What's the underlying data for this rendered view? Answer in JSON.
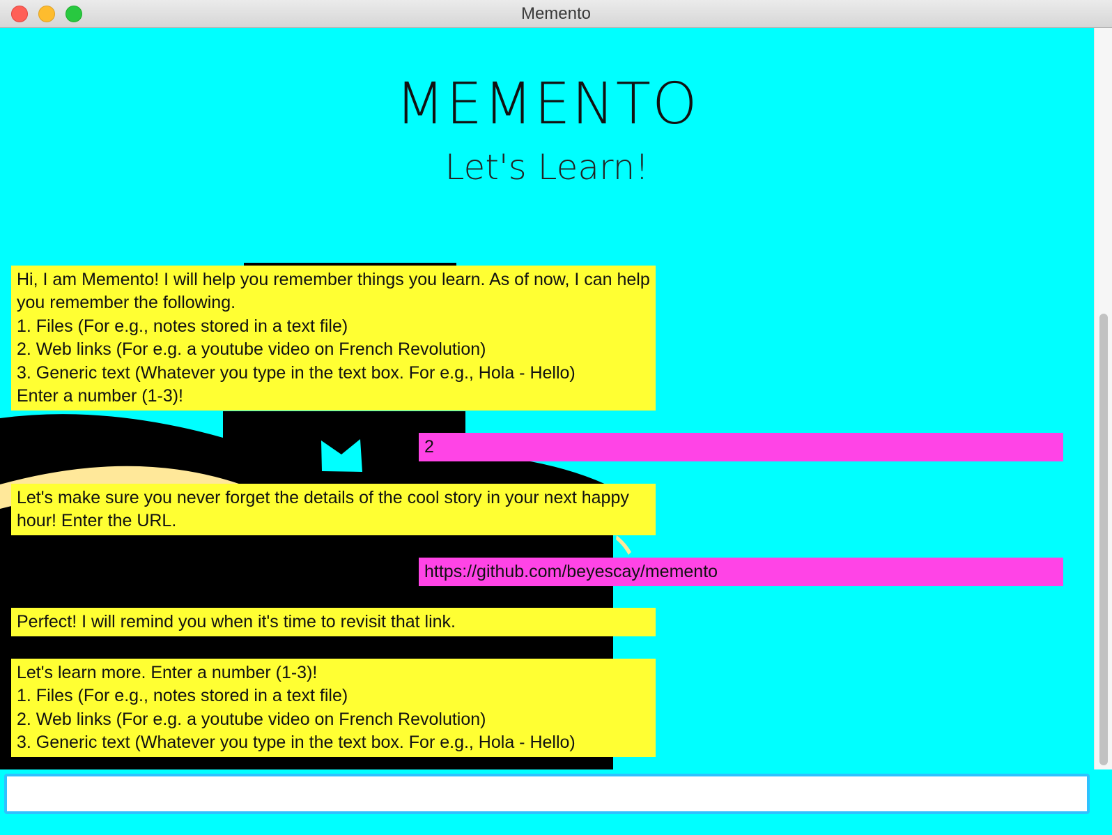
{
  "window": {
    "title": "Memento"
  },
  "header": {
    "title": "MEMENTO",
    "subtitle": "Let's Learn!"
  },
  "messages": [
    {
      "sender": "bot",
      "text": "Hi, I am Memento! I will help you remember things you learn. As of now, I can help you remember the following.\n1. Files (For e.g., notes stored in a text file)\n2. Web links (For e.g. a youtube video on French Revolution)\n3. Generic text (Whatever you type in the text box. For e.g., Hola - Hello)\nEnter a number (1-3)!"
    },
    {
      "sender": "user",
      "text": "2"
    },
    {
      "sender": "bot",
      "text": "Let's make sure you never forget the details of the cool story in your next happy hour! Enter the URL."
    },
    {
      "sender": "user",
      "text": "https://github.com/beyescay/memento"
    },
    {
      "sender": "bot",
      "text": "Perfect! I will remind you when it's time to revisit that link."
    },
    {
      "sender": "bot",
      "text": "Let's learn more. Enter a number (1-3)!\n1. Files (For e.g., notes stored in a text file)\n2. Web links (For e.g. a youtube video on French Revolution)\n3. Generic text (Whatever you type in the text box. For e.g., Hola - Hello)"
    }
  ],
  "input": {
    "value": "",
    "placeholder": ""
  },
  "colors": {
    "background": "#00ffff",
    "bot_bubble": "#ffff33",
    "user_bubble": "#ff44e6",
    "input_border": "#2fc1ff"
  }
}
